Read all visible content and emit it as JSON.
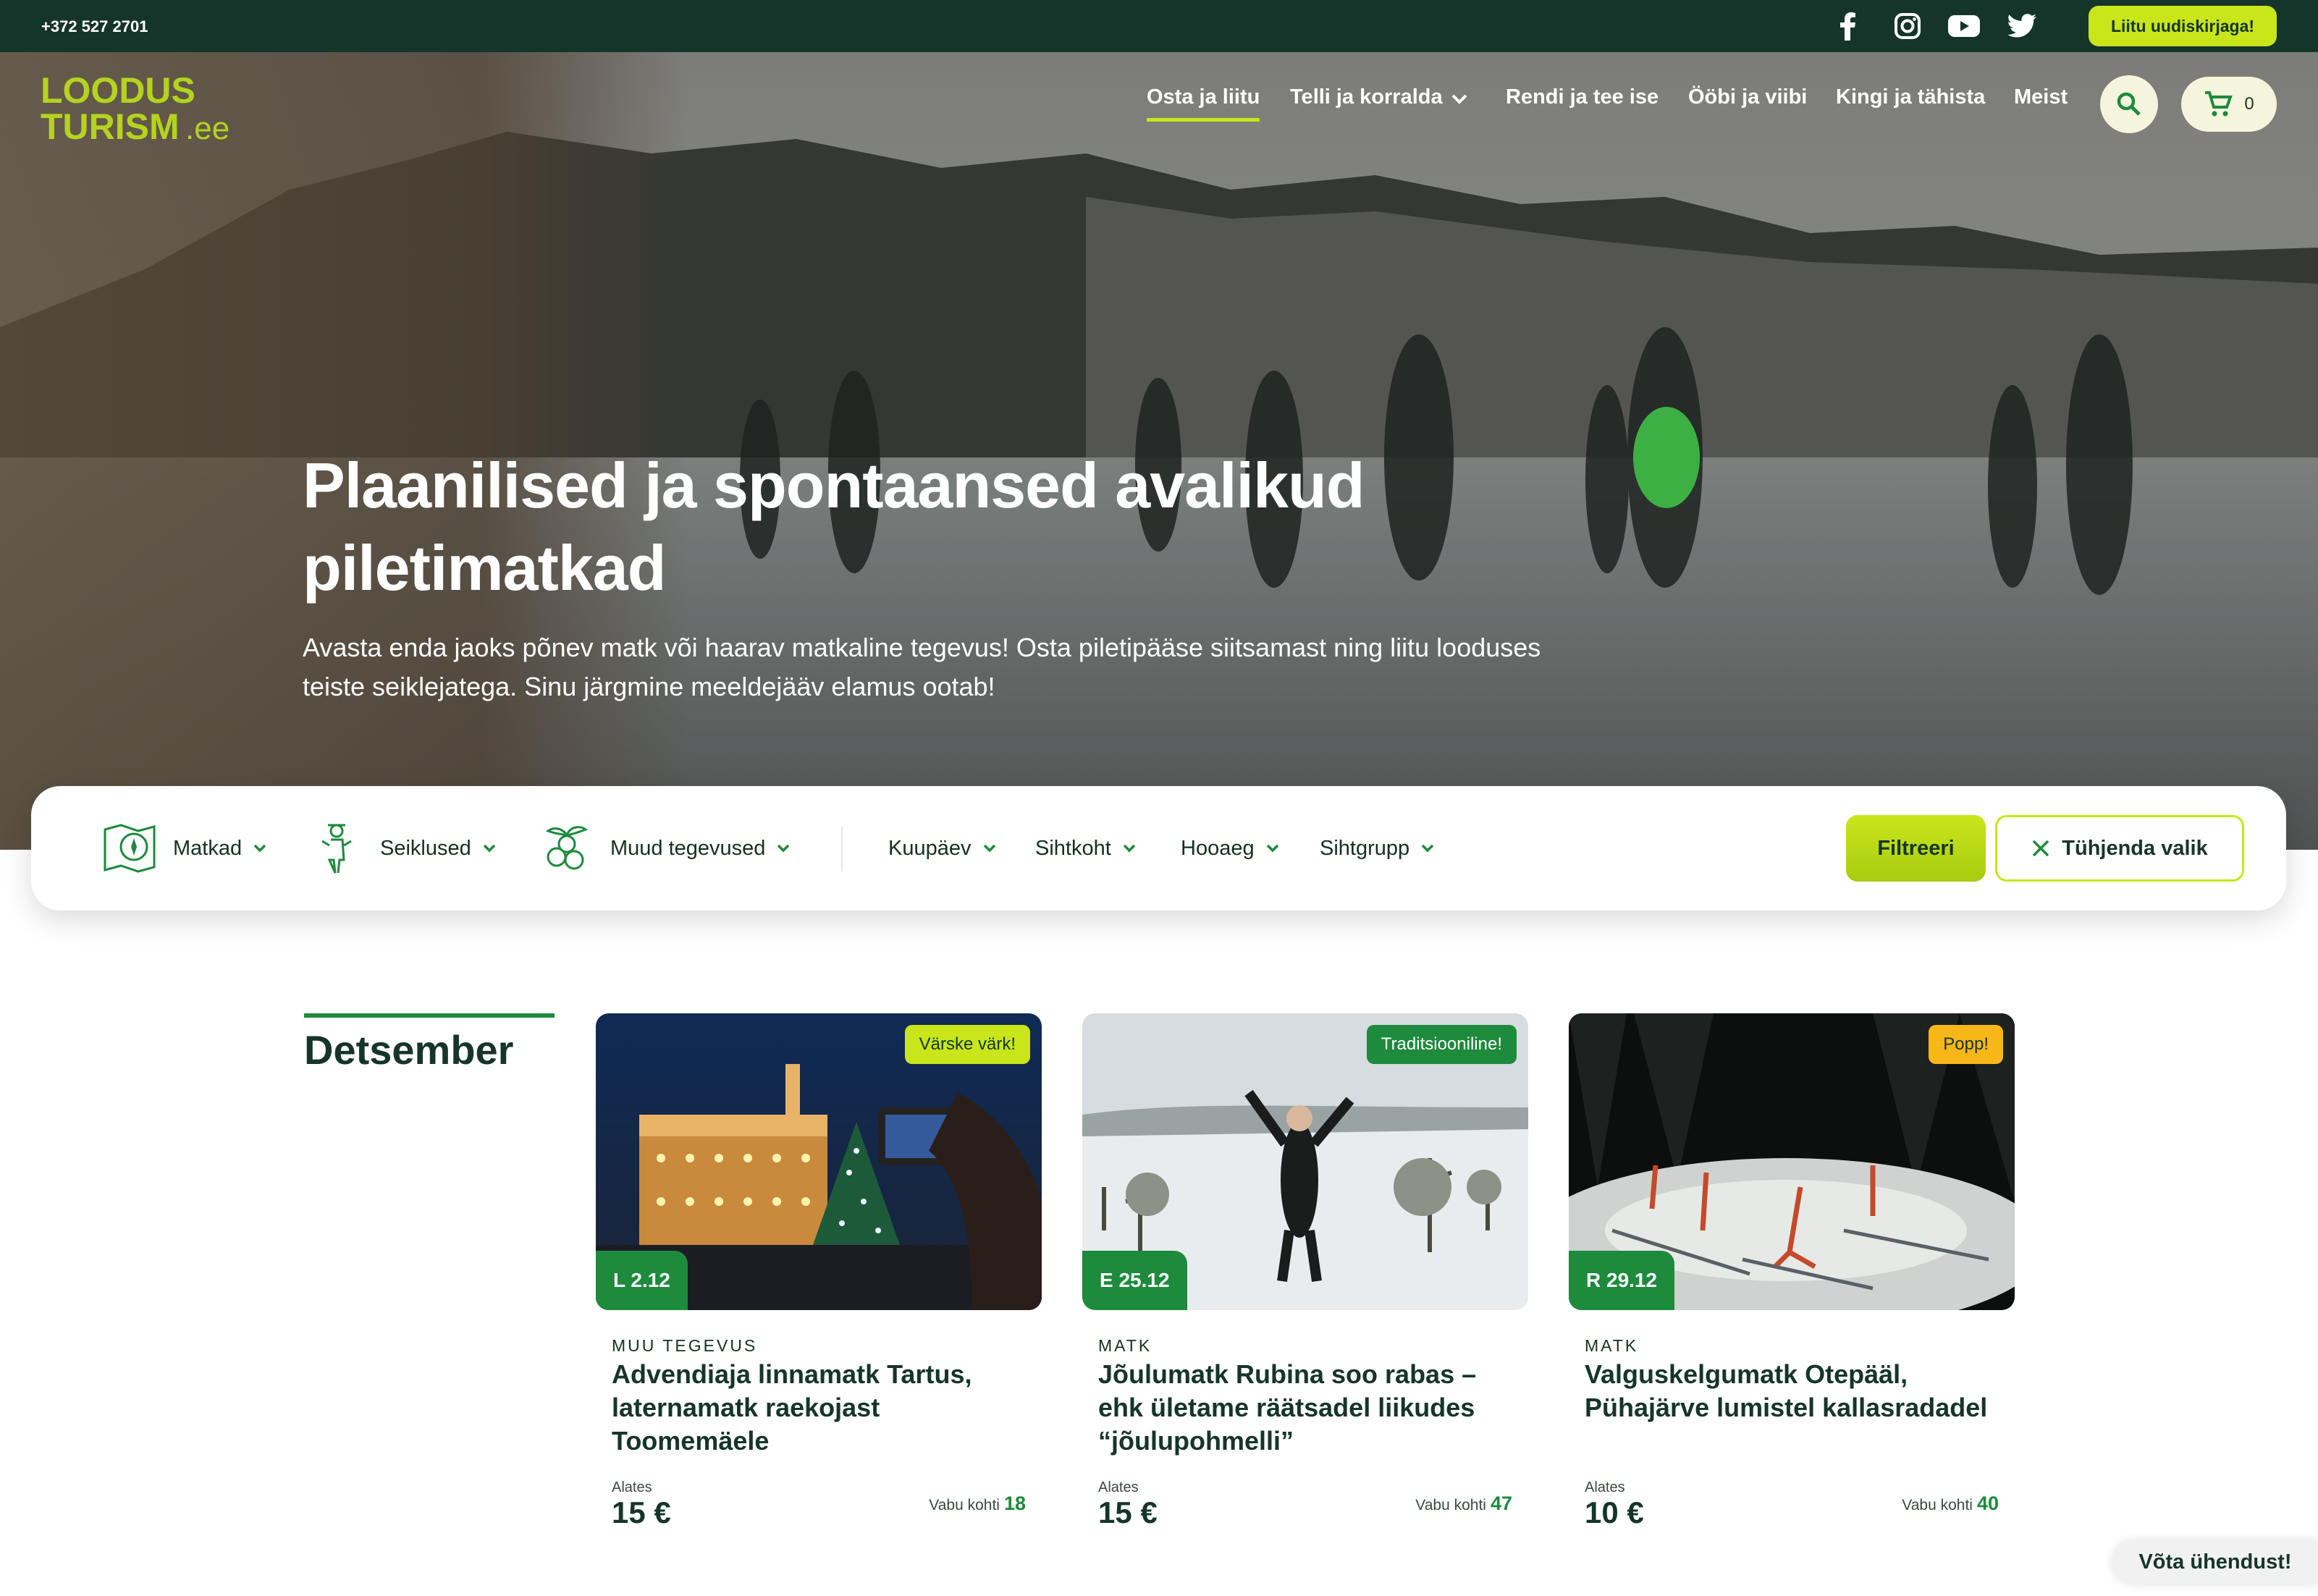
{
  "topbar": {
    "phone": "+372 527 2701",
    "social_icons": [
      "facebook-icon",
      "instagram-icon",
      "youtube-icon",
      "twitter-icon"
    ],
    "newsletter_label": "Liitu uudiskirjaga!"
  },
  "brand": {
    "logo_text_line1": "LOODUS",
    "logo_text_line2": "TURISM",
    "logo_suffix": ".ee",
    "primary_color": "#16352a",
    "accent_color": "#c8e61a",
    "green_color": "#1d8a3c"
  },
  "nav": {
    "items": [
      {
        "label": "Osta ja liitu",
        "active": true
      },
      {
        "label": "Telli ja korralda",
        "dropdown": true
      },
      {
        "label": "Rendi ja tee ise"
      },
      {
        "label": "Ööbi ja viibi"
      },
      {
        "label": "Kingi ja tähista"
      },
      {
        "label": "Meist"
      }
    ],
    "cart_count": "0"
  },
  "hero": {
    "title": "Plaanilised ja spontaansed avalikud piletimatkad",
    "subtitle": "Avasta enda jaoks põnev matk või haarav matkaline tegevus! Osta piletipääse siitsamast ning liitu looduses teiste seiklejatega. Sinu järgmine meeldejääv elamus ootab!"
  },
  "filters": {
    "categories": [
      {
        "label": "Matkad",
        "icon": "map-compass-icon"
      },
      {
        "label": "Seiklused",
        "icon": "adventurer-icon"
      },
      {
        "label": "Muud tegevused",
        "icon": "berries-icon"
      }
    ],
    "selects": [
      "Kuupäev",
      "Sihtkoht",
      "Hooaeg",
      "Sihtgrupp"
    ],
    "filter_button": "Filtreeri",
    "clear_button": "Tühjenda valik"
  },
  "month": "Detsember",
  "cards": [
    {
      "badge": "Värske värk!",
      "badge_color": "#c8e61a",
      "date": "L 2.12",
      "category": "MUU TEGEVUS",
      "title": "Advendiaja linnamatk Tartus, laternamatk raekojast Toomemäele",
      "from_label": "Alates",
      "price": "15 €",
      "avail_label": "Vabu kohti",
      "avail": "18"
    },
    {
      "badge": "Traditsiooniline!",
      "badge_color": "#1d8a3c",
      "date": "E 25.12",
      "category": "MATK",
      "title": "Jõulumatk Rubina soo rabas – ehk ületame räätsadel liikudes “jõulupohmelli”",
      "from_label": "Alates",
      "price": "15 €",
      "avail_label": "Vabu kohti",
      "avail": "47"
    },
    {
      "badge": "Popp!",
      "badge_color": "#f7b718",
      "date": "R 29.12",
      "category": "MATK",
      "title": "Valguskelgumatk Otepääl, Pühajärve lumistel kallasradadel",
      "from_label": "Alates",
      "price": "10 €",
      "avail_label": "Vabu kohti",
      "avail": "40"
    }
  ],
  "contact_label": "Võta ühendust!"
}
